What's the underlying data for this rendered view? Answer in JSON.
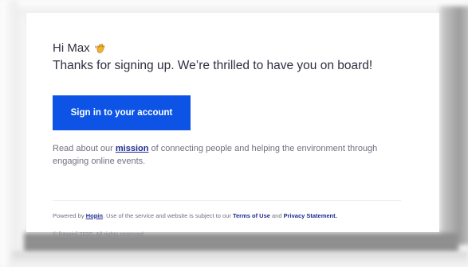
{
  "email": {
    "greeting": "Hi Max",
    "wave_icon": "waving-hand-icon",
    "headline": "Thanks for signing up. We’re thrilled to have you on board!",
    "cta_label": "Sign in to your account",
    "about_prefix": "Read about our ",
    "about_link": "mission",
    "about_suffix": " of connecting people and helping the environment through engaging online events.",
    "footer": {
      "powered_prefix": "Powered by ",
      "brand_link": "Hopin",
      "middle_text": ". Use of the service and website is subject to our ",
      "terms_link": "Terms of Use",
      "and_text": " and ",
      "privacy_link": "Privacy Statement.",
      "copyright": "© [Hopin] 2020. All rights reserved."
    }
  },
  "colors": {
    "accent": "#0d54e6",
    "link": "#1f2a8f",
    "text": "#2f3042",
    "muted": "#6f7180"
  }
}
